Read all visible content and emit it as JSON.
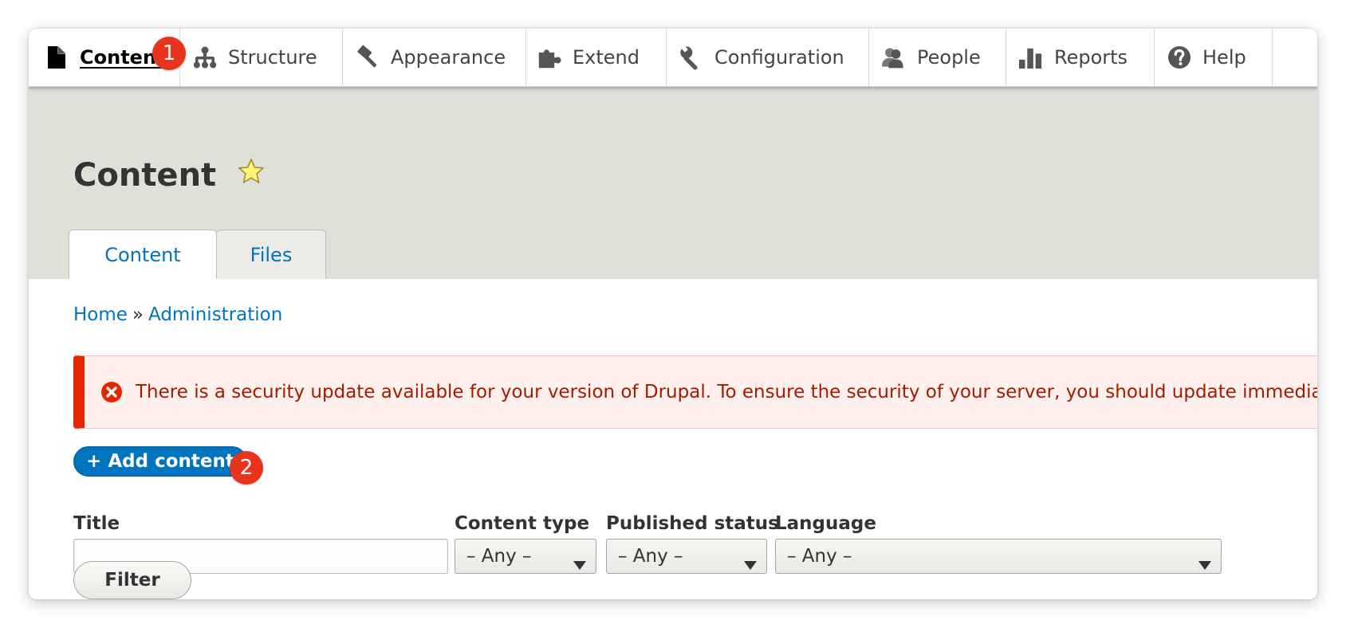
{
  "toolbar": {
    "items": [
      {
        "label": "Content",
        "icon": "document-icon"
      },
      {
        "label": "Structure",
        "icon": "sitemap-icon"
      },
      {
        "label": "Appearance",
        "icon": "paintbrush-icon"
      },
      {
        "label": "Extend",
        "icon": "puzzle-icon"
      },
      {
        "label": "Configuration",
        "icon": "wrench-icon"
      },
      {
        "label": "People",
        "icon": "people-icon"
      },
      {
        "label": "Reports",
        "icon": "bar-chart-icon"
      },
      {
        "label": "Help",
        "icon": "help-icon"
      }
    ]
  },
  "markers": {
    "one": "1",
    "two": "2"
  },
  "page": {
    "title": "Content"
  },
  "tabs": [
    {
      "label": "Content",
      "active": true
    },
    {
      "label": "Files",
      "active": false
    }
  ],
  "breadcrumb": {
    "home": "Home",
    "separator": "»",
    "admin": "Administration"
  },
  "alert": {
    "message": "There is a security update available for your version of Drupal. To ensure the security of your server, you should update immediately!"
  },
  "actions": {
    "add_content": "+ Add content"
  },
  "filters": {
    "title_label": "Title",
    "title_value": "",
    "content_type_label": "Content type",
    "content_type_value": "– Any –",
    "status_label": "Published status",
    "status_value": "– Any –",
    "language_label": "Language",
    "language_value": "– Any –",
    "filter_button": "Filter"
  },
  "colors": {
    "link": "#0074bd",
    "error": "#e62600",
    "header_bg": "#e0dfd8",
    "marker": "#e8341c"
  }
}
